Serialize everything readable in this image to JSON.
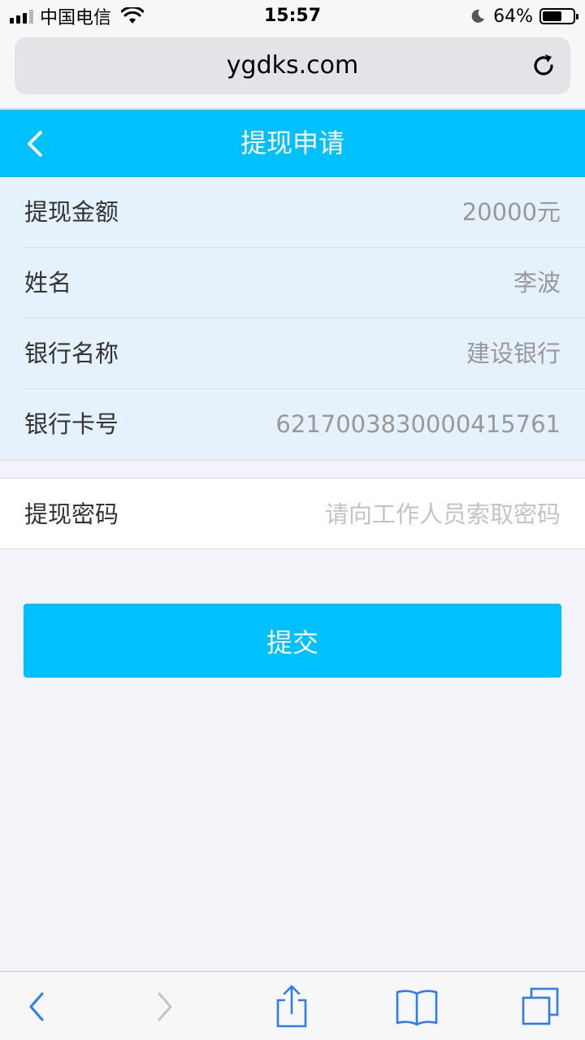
{
  "status_bar": {
    "carrier": "中国电信",
    "time": "15:57",
    "battery": "64%",
    "battery_level": 0.64,
    "icons": [
      "signal-icon",
      "wifi-icon",
      "moon-icon",
      "battery-icon"
    ]
  },
  "browser": {
    "url": "ygdks.com",
    "reload_icon": "reload-icon"
  },
  "header": {
    "title": "提现申请",
    "back_icon": "chevron-left-icon"
  },
  "info": {
    "rows": [
      {
        "label": "提现金额",
        "value": "20000元"
      },
      {
        "label": "姓名",
        "value": "李波"
      },
      {
        "label": "银行名称",
        "value": "建设银行"
      },
      {
        "label": "银行卡号",
        "value": "6217003830000415761"
      }
    ]
  },
  "password": {
    "label": "提现密码",
    "placeholder": "请向工作人员索取密码",
    "value": ""
  },
  "submit_label": "提交",
  "colors": {
    "accent": "#00c1fe",
    "info_bg": "#e5f1fb",
    "page_bg": "#f3f4f9",
    "ios_blue": "#2d7cf6"
  },
  "toolbar": {
    "icons": [
      "back-icon",
      "forward-icon",
      "share-icon",
      "bookmarks-icon",
      "tabs-icon"
    ]
  }
}
